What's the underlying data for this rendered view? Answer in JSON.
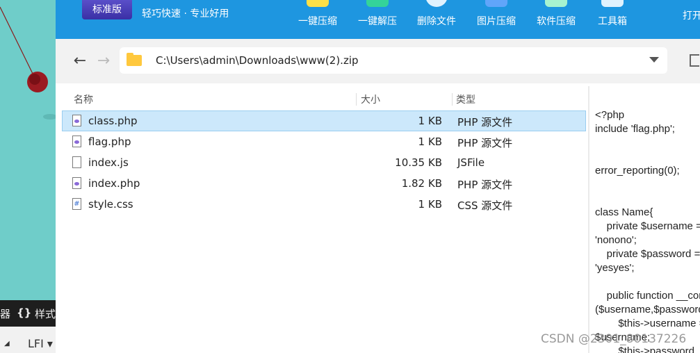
{
  "background_app": {
    "bottom_bar_items": [
      "器",
      "{}",
      "样式"
    ],
    "lower_bar_items": [
      "◢",
      "LFI ▾"
    ]
  },
  "toolbar": {
    "logo_text": "标准版",
    "slogan": "轻巧快速 · 专业好用",
    "tools": [
      {
        "label": "一键压缩",
        "color": "#fde047"
      },
      {
        "label": "一键解压",
        "color": "#34d399"
      },
      {
        "label": "删除文件",
        "color": "#e0f2fe"
      },
      {
        "label": "图片压缩",
        "color": "#60a5fa"
      },
      {
        "label": "软件压缩",
        "color": "#a7f3d0"
      },
      {
        "label": "工具箱",
        "color": "#e0f2fe"
      }
    ],
    "more_label": "打开"
  },
  "address": {
    "back_icon": "←",
    "forward_icon": "→",
    "path": "C:\\Users\\admin\\Downloads\\www(2).zip"
  },
  "file_list": {
    "columns": {
      "name": "名称",
      "size": "大小",
      "type": "类型"
    },
    "rows": [
      {
        "name": "class.php",
        "size": "1 KB",
        "type": "PHP 源文件",
        "icon": "php-file-icon",
        "selected": true
      },
      {
        "name": "flag.php",
        "size": "1 KB",
        "type": "PHP 源文件",
        "icon": "php-file-icon",
        "selected": false
      },
      {
        "name": "index.js",
        "size": "10.35 KB",
        "type": "JSFile",
        "icon": "blank-file-icon",
        "selected": false
      },
      {
        "name": "index.php",
        "size": "1.82 KB",
        "type": "PHP 源文件",
        "icon": "php-file-icon",
        "selected": false
      },
      {
        "name": "style.css",
        "size": "1 KB",
        "type": "CSS 源文件",
        "icon": "css-file-icon",
        "selected": false
      }
    ]
  },
  "preview": {
    "code": "<?php\ninclude 'flag.php';\n\n\nerror_reporting(0);\n\n\nclass Name{\n    private $username = \n'nonono';\n    private $password = \n'yesyes';\n\n    public function __construct\n($username,$password){\n        $this->username = \n$username;\n        $this->password"
  },
  "watermark": "CSDN @2301_80137226",
  "colors": {
    "toolbar_blue": "#1e96e0",
    "selection": "#cce8fb",
    "bg_teal": "#6fcdc9"
  }
}
